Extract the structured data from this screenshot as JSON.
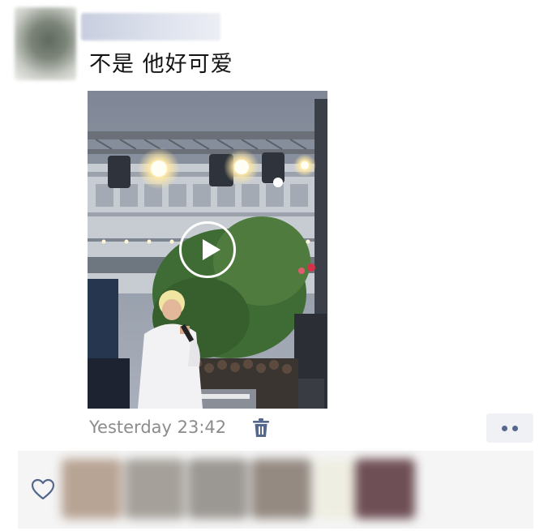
{
  "post": {
    "text": "不是 他好可爱",
    "timestamp": "Yesterday 23:42"
  },
  "icons": {
    "play": "play-icon",
    "trash": "trash-icon",
    "more": "more-dots-icon",
    "heart": "heart-outline-icon"
  },
  "colors": {
    "link_blue": "#56678e",
    "timestamp_gray": "#8c8c8c",
    "likes_bg": "#f5f5f5",
    "more_bg": "#f0f1f4"
  }
}
